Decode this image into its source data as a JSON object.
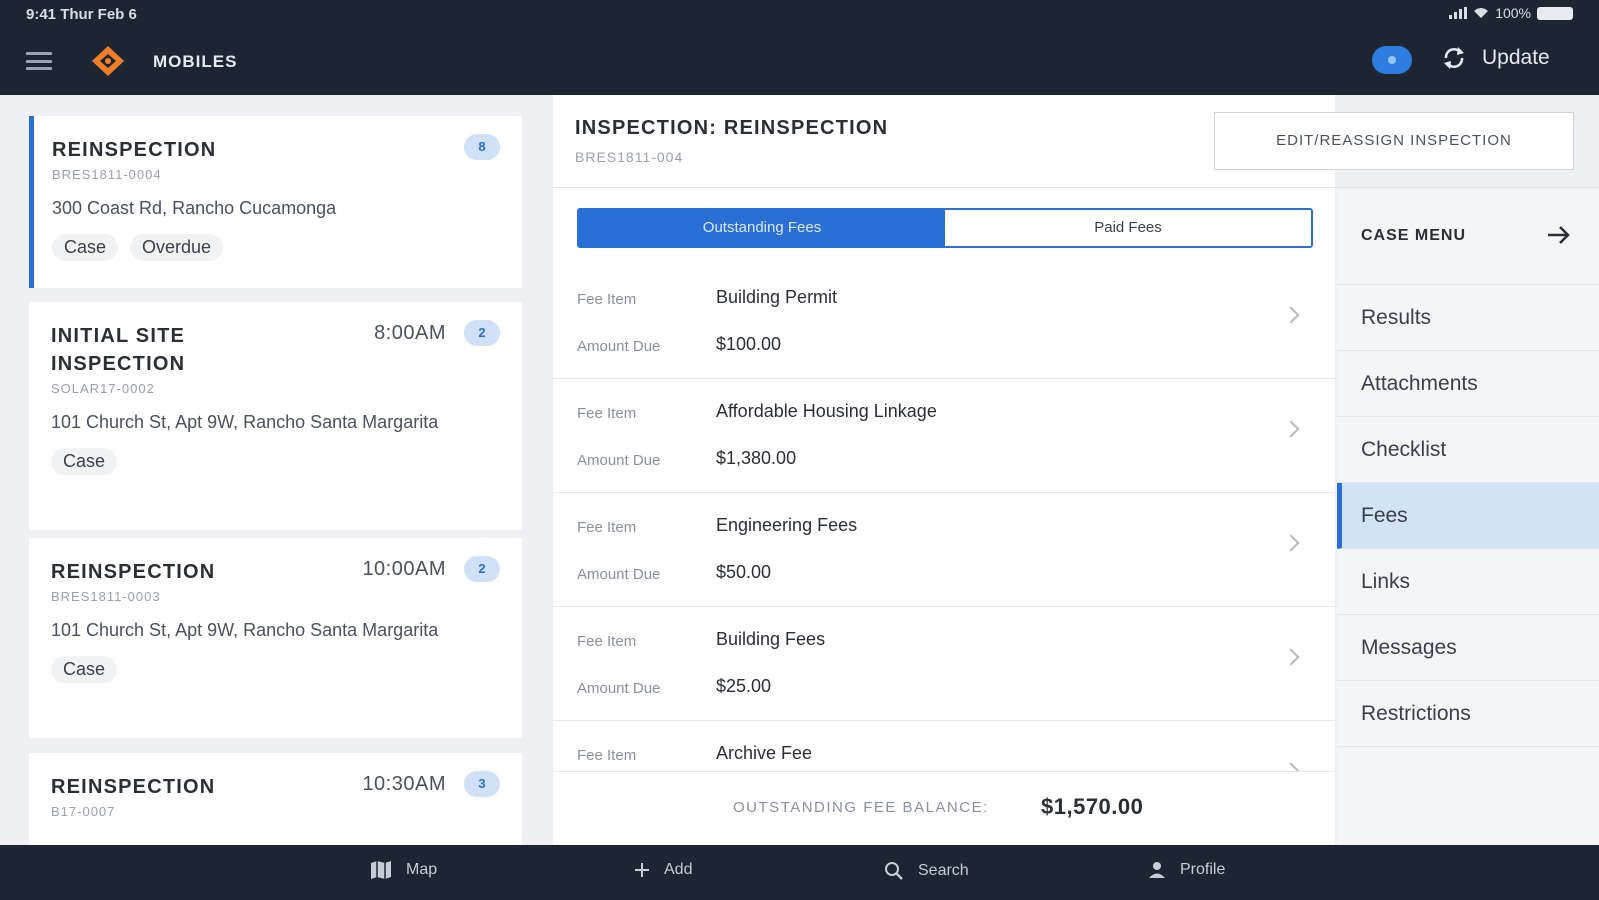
{
  "status_bar": {
    "time": "9:41  Thur Feb 6",
    "battery": "100%"
  },
  "header": {
    "brand": "MOBILES",
    "update_label": "Update"
  },
  "inspections": [
    {
      "title": "REINSPECTION",
      "time": "",
      "count": "8",
      "id": "BRES1811-0004",
      "address": "300 Coast Rd, Rancho Cucamonga",
      "tags": [
        "Case",
        "Overdue"
      ]
    },
    {
      "title": "INITIAL SITE INSPECTION",
      "time": "8:00AM",
      "count": "2",
      "id": "SOLAR17-0002",
      "address": "101 Church St, Apt 9W, Rancho Santa Margarita",
      "tags": [
        "Case"
      ]
    },
    {
      "title": "REINSPECTION",
      "time": "10:00AM",
      "count": "2",
      "id": "BRES1811-0003",
      "address": "101 Church St, Apt 9W, Rancho Santa Margarita",
      "tags": [
        "Case"
      ]
    },
    {
      "title": "REINSPECTION",
      "time": "10:30AM",
      "count": "3",
      "id": "B17-0007",
      "address": "",
      "tags": []
    }
  ],
  "detail": {
    "title": "INSPECTION: REINSPECTION",
    "id": "BRES1811-004",
    "edit_button": "EDIT/REASSIGN INSPECTION",
    "tabs": [
      "Outstanding Fees",
      "Paid Fees"
    ],
    "fee_item_label": "Fee Item",
    "amount_due_label": "Amount Due",
    "fees": [
      {
        "item": "Building Permit",
        "amount": "$100.00"
      },
      {
        "item": "Affordable Housing Linkage",
        "amount": "$1,380.00"
      },
      {
        "item": "Engineering Fees",
        "amount": "$50.00"
      },
      {
        "item": "Building Fees",
        "amount": "$25.00"
      },
      {
        "item": "Archive Fee",
        "amount": ""
      }
    ],
    "balance_label": "OUTSTANDING FEE BALANCE:",
    "balance_value": "$1,570.00"
  },
  "case_menu": {
    "title": "CASE MENU",
    "items": [
      "Results",
      "Attachments",
      "Checklist",
      "Fees",
      "Links",
      "Messages",
      "Restrictions"
    ],
    "selected": "Fees"
  },
  "bottom_tabs": [
    "Map",
    "Add",
    "Search",
    "Profile"
  ],
  "colors": {
    "accent": "#2a6fd6",
    "header_bg": "#1d2533",
    "selected_bg": "#d3e3f6",
    "logo": "#f07f2b"
  }
}
